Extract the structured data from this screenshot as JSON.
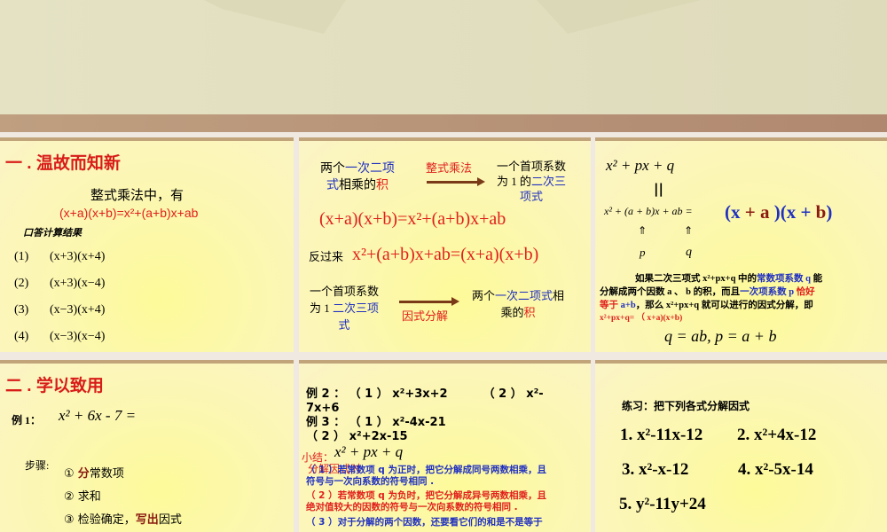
{
  "slides": [
    {
      "title": "一 . 温故而知新",
      "subtitle": "整式乘法中，有",
      "formula": "(x+a)(x+b)=x²+(a+b)x+ab",
      "oral": "口答计算结果",
      "items": [
        {
          "n": "(1)",
          "e": "(x+3)(x+4)"
        },
        {
          "n": "(2)",
          "e": "(x+3)(x−4)"
        },
        {
          "n": "(3)",
          "e": "(x−3)(x+4)"
        },
        {
          "n": "(4)",
          "e": "(x−3)(x−4)"
        }
      ]
    },
    {
      "left1a": "两个",
      "left1b": "一次二项",
      "left1c": "式",
      "left1d": "相乘的",
      "left1e": "积",
      "arrow1": "整式乘法",
      "right1a": "一个首项系数",
      "right1b": "为 1 的",
      "right1c": "二次三",
      "right1d": "项式",
      "eq1": "(x+a)(x+b)=x²+(a+b)x+ab",
      "reverse": "反过来",
      "eq2": "x²+(a+b)x+ab=(x+a)(x+b)",
      "left2a": "一个首项系数",
      "left2b": "为 1 ",
      "left2c": "二次三项",
      "left2d": "式",
      "arrow2": "因式分解",
      "right2a": "两个",
      "right2b": "一次二项式",
      "right2c": "相",
      "right2d": "乘的",
      "right2e": "积"
    },
    {
      "top": "x² + px + q",
      "eqsign": "||",
      "mid": "x² + (a + b)x + ab =",
      "big_x1": "(x ",
      "big_a": " + a ",
      "big_x2": ")(x + ",
      "big_b": "b",
      "big_end": ")",
      "up": "⇑",
      "p": "p",
      "q": "q",
      "para": [
        [
          "如果二次三项式 x²+px+q 中的",
          "常数项系数 q",
          "能"
        ],
        [
          "分解成两个因数 a 、 b 的积，而且",
          "一次项系数 p",
          "恰好"
        ],
        [
          "等于",
          "a+b",
          "，那么 x²+px+q 就可以进行的因式分解，即"
        ],
        [
          "x²+px+q=",
          "（ x+a)(x+b)"
        ]
      ],
      "result": "q = ab, p = a + b"
    },
    {
      "title": "二 . 学以致用",
      "ex_label": "例 1：",
      "ex_expr": "x² + 6x - 7 =",
      "steps_label": "步骤:",
      "steps": [
        {
          "pre": "① ",
          "hl": "分",
          "post": "常数项"
        },
        {
          "pre": "② 求和",
          "hl": "",
          "post": ""
        },
        {
          "pre": "③ 检验确定，",
          "hl": "写出",
          "post": "因式"
        }
      ]
    },
    {
      "ex2a": "例 2 ： （ 1 ） x²+3x+2",
      "ex2b": "（ 2 ） x²-",
      "ex2c": "7x+6",
      "ex3a": "例 3 ： （ 1 ） x²-4x-21",
      "ex3b": "（ 2 ） x²+2x-15",
      "summary_label": "小结：",
      "summary_expr": "x² + px + q",
      "summary_sub": "分解因式时",
      "rule1a": "（ 1 ）若常数项 q 为正时，把它分解成同号两数相乘，且",
      "rule1b": "符号与一次向系数的符号相同 .",
      "rule2a": "（ 2 ）若常数项 q 为负时，把它分解成异号两数相乘，且",
      "rule2b": "绝对值较大的因数的符号与一次向系数的符号相同 .",
      "rule3a": "（ 3 ）对于分解的两个因数，还要看它们的和是不是等于"
    },
    {
      "label": "练习：把下列各式分解因式",
      "items": [
        "1. x²-11x-12",
        "2.  x²+4x-12",
        "3. x²-x-12",
        "4. x²-5x-14",
        "5.  y²-11y+24"
      ]
    }
  ],
  "colors": {
    "band": "#b89478",
    "slide_bg": "#fcf7b0",
    "red": "#e0201c",
    "blue": "#2030c0"
  }
}
